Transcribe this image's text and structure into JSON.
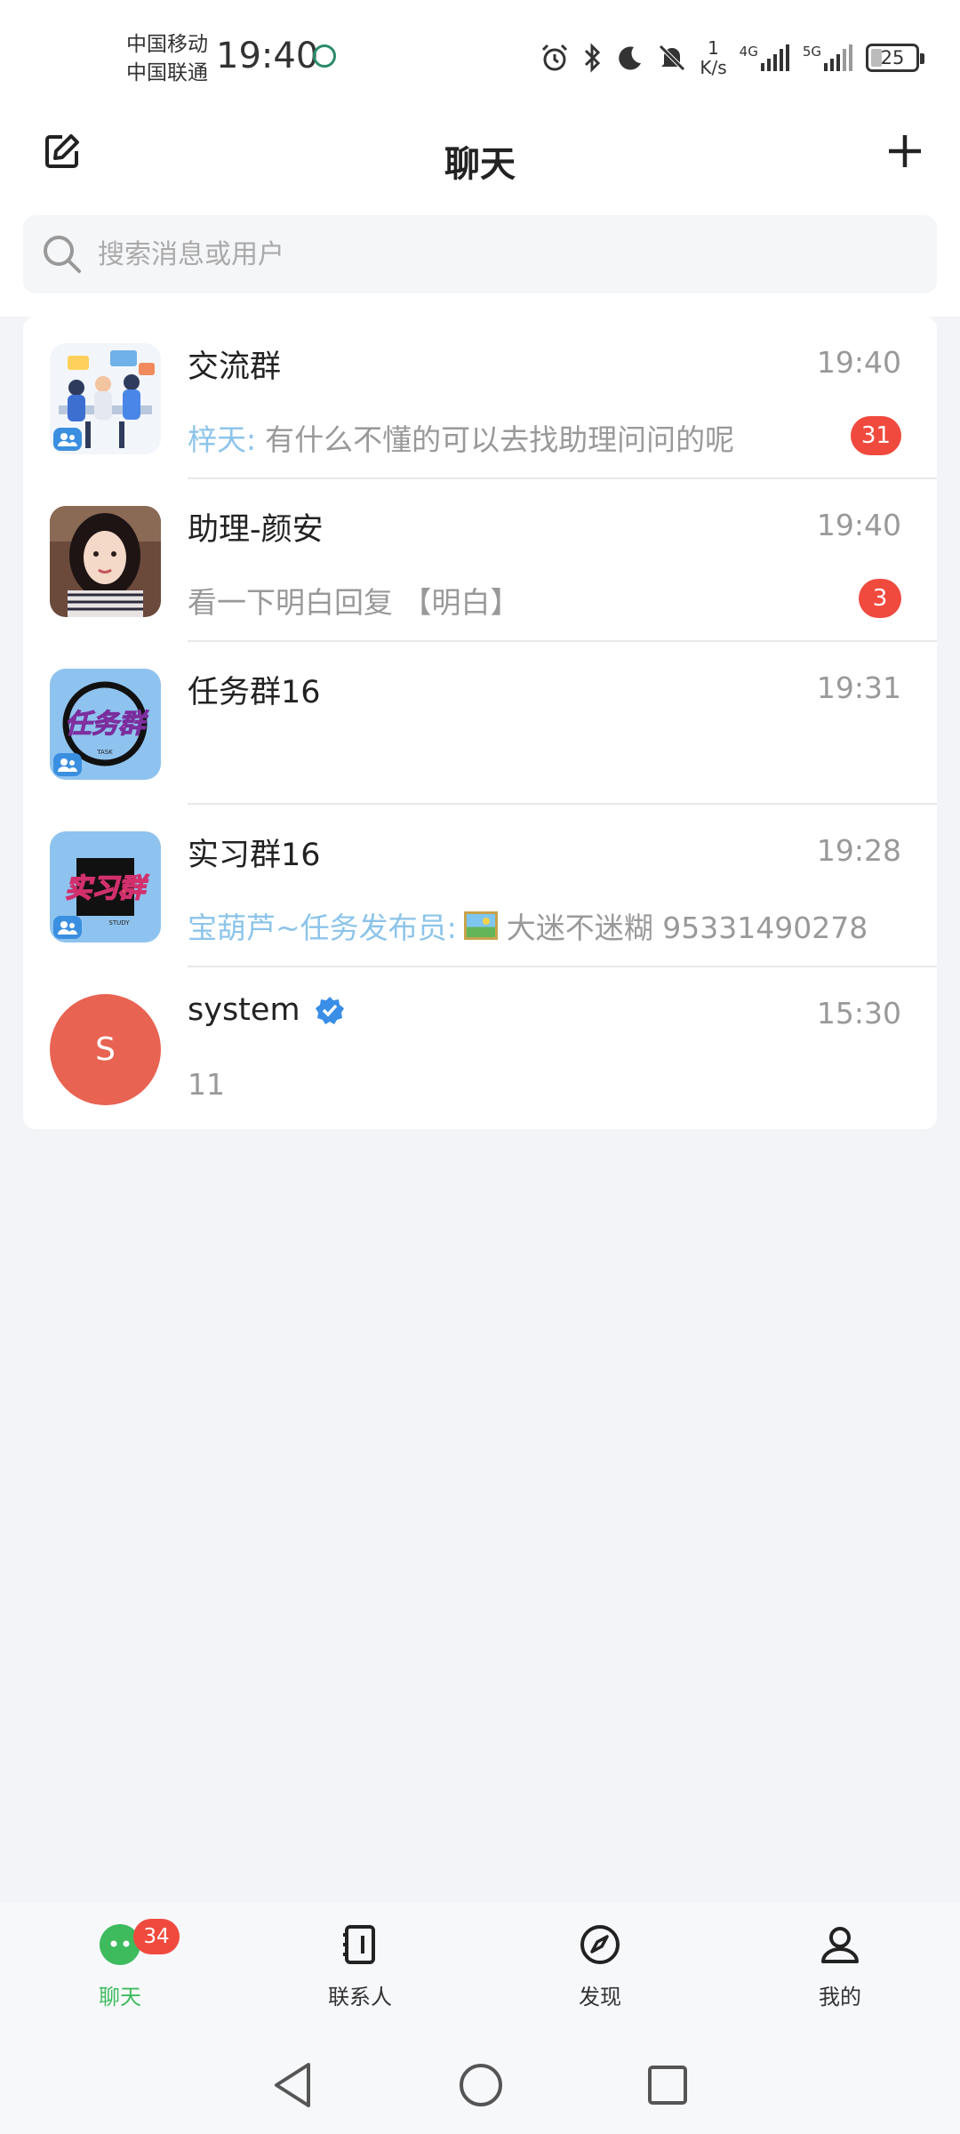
{
  "status_bar": {
    "carrier_1": "中国移动",
    "carrier_2": "中国联通",
    "time": "19:40",
    "net_speed_value": "1",
    "net_speed_unit": "K/s",
    "net_4g": "4G",
    "net_5g": "5G",
    "battery": "25"
  },
  "header": {
    "title": "聊天"
  },
  "search": {
    "placeholder": "搜索消息或用户"
  },
  "chats": [
    {
      "name": "交流群",
      "time": "19:40",
      "sender": "梓天:",
      "message": "有什么不懂的可以去找助理问问的呢",
      "unread": "31"
    },
    {
      "name": "助理-颜安",
      "time": "19:40",
      "message": "看一下明白回复 【明白】",
      "unread": "3"
    },
    {
      "name": "任务群16",
      "time": "19:31",
      "avatar_text": "任务群",
      "avatar_sub": "TASK"
    },
    {
      "name": "实习群16",
      "time": "19:28",
      "sender": "宝葫芦~任务发布员:",
      "message_after_image": "大迷不迷糊 95331490278",
      "avatar_text": "实习群",
      "avatar_sub": "STUDY"
    },
    {
      "name": "system",
      "time": "15:30",
      "message": "11",
      "avatar_letter": "S"
    }
  ],
  "tabbar": {
    "items": [
      {
        "label": "聊天",
        "badge": "34"
      },
      {
        "label": "联系人"
      },
      {
        "label": "发现"
      },
      {
        "label": "我的"
      }
    ]
  },
  "colors": {
    "accent_green": "#3dbb5d",
    "badge_red": "#f04a3e",
    "sender_blue": "#8cc4ea",
    "system_avatar": "#e86352"
  }
}
